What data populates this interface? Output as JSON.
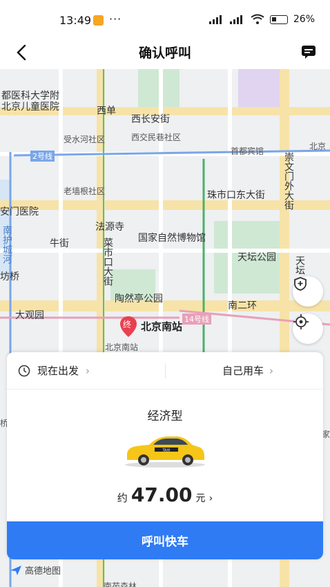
{
  "status": {
    "time": "13:49",
    "dots": "···",
    "battery": "26%"
  },
  "header": {
    "title": "确认呼叫"
  },
  "map": {
    "labels": {
      "hospital1": "都医科大学附",
      "hospital2": "北京儿童医院",
      "xidan": "西单",
      "xichangan": "西长安街",
      "shoushui": "受水河社区",
      "xijiao": "西交民巷社区",
      "shoudu": "首都宾馆",
      "beijing_r": "北京",
      "line2": "2号线",
      "chongwen": "崇文门外大街",
      "laoqiang": "老墙根社区",
      "zhushikou": "珠市口东大街",
      "anmen": "安门医院",
      "fayuan": "法源寺",
      "niujie": "牛街",
      "caishikou": "菜市口大街",
      "nature": "国家自然博物馆",
      "temple": "天坛公园",
      "tian": "天坛",
      "nanhu": "南护城河",
      "fangqiao": "坊桥",
      "taoran": "陶然亭公园",
      "nan2huan": "南二环",
      "daguan": "大观园",
      "line14": "14号线",
      "bjsouth": "北京南站",
      "bjsouth_sub": "北京南站",
      "marker": "终",
      "jia": "家",
      "qiao": "桥",
      "nanyuan": "南苑森林"
    }
  },
  "panel": {
    "depart": "现在出发",
    "self_car": "自己用车",
    "car_type": "经济型",
    "price_prefix": "约",
    "price": "47.00",
    "price_unit": "元",
    "call_button": "呼叫快车",
    "taxi_sign": "TAXI"
  },
  "brand": "高德地图"
}
